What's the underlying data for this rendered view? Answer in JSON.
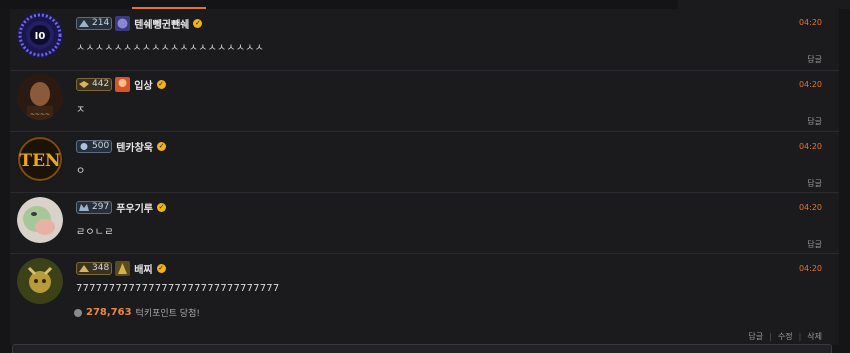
{
  "colors": {
    "accent": "#e2742f",
    "verified": "#f0b419",
    "background": "#1b1b1e"
  },
  "comments": [
    {
      "level": "214",
      "nickname": "텐쉐뼁귄뺀쉐",
      "time": "04:20",
      "text": "ㅅㅅㅅㅅㅅㅅㅅㅅㅅㅅㅅㅅㅅㅅㅅㅅㅅㅅㅅㅅ",
      "reply_label": "답글"
    },
    {
      "level": "442",
      "nickname": "입상",
      "time": "04:20",
      "text": "ㅈ",
      "reply_label": "답글"
    },
    {
      "level": "500",
      "nickname": "텐카창욱",
      "avatar_text": "TEN",
      "time": "04:20",
      "text": "ㅇ",
      "reply_label": "답글"
    },
    {
      "level": "297",
      "nickname": "푸우기루",
      "time": "04:20",
      "text": "ㄹㅇㄴㄹ",
      "reply_label": "답글"
    },
    {
      "level": "348",
      "nickname": "배찌",
      "time": "04:20",
      "text": "7777777777777777777777777777777",
      "reply_label": "답글",
      "edit_label": "수정",
      "delete_label": "삭제",
      "point_amount": "278,763",
      "point_text": "턱키포인트 당첨!"
    }
  ]
}
